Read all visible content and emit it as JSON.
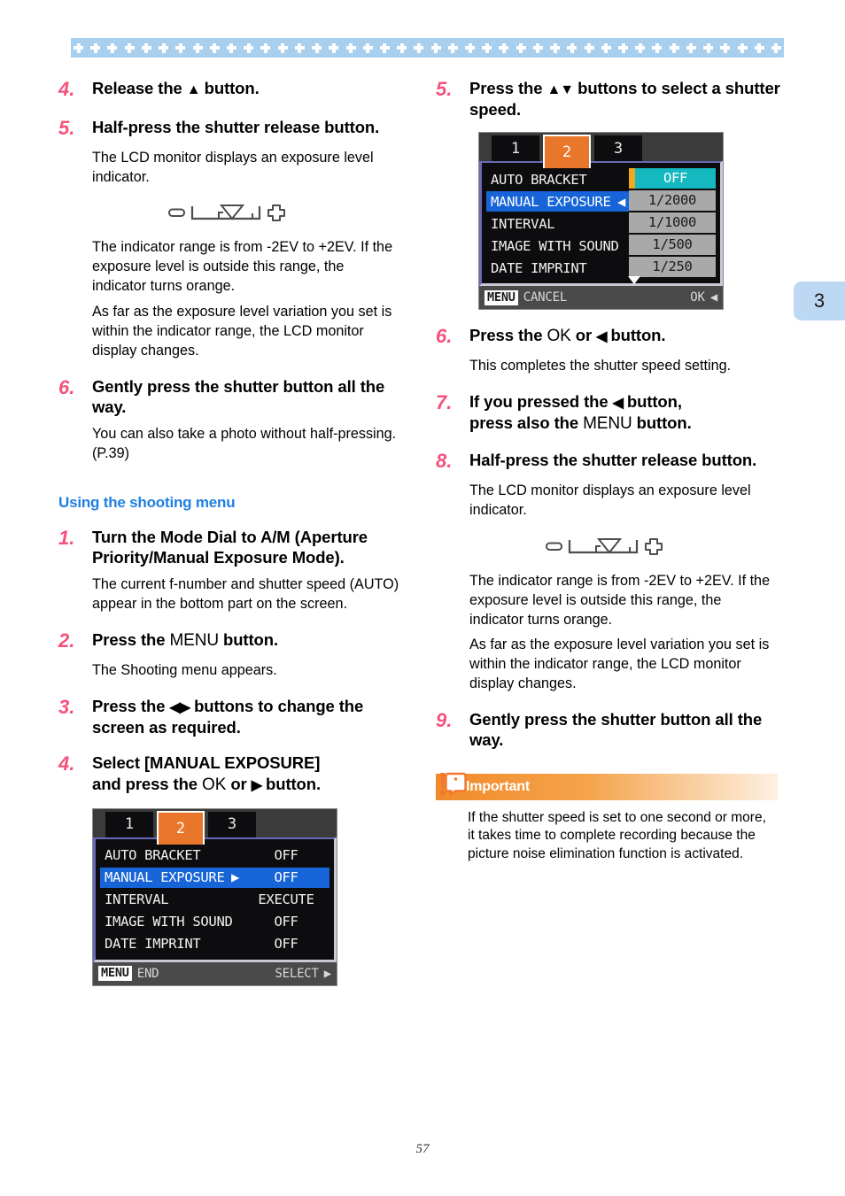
{
  "page": {
    "folio": "57",
    "tab_number": "3"
  },
  "left_column": {
    "steps": [
      {
        "num": "4.",
        "title_pre": "Release the ",
        "icon": "▲",
        "title_post": " button.",
        "paras": []
      },
      {
        "num": "5.",
        "title_pre": "Half-press the shutter release button.",
        "icon": "",
        "title_post": "",
        "paras": [
          "The LCD monitor displays an exposure level indicator."
        ]
      }
    ],
    "after_indicator_paras": [
      "The indicator range is from -2EV to +2EV. If the exposure level is outside this range, the indicator turns orange.",
      "As far as  the exposure level variation you set is within the indicator range, the LCD monitor display changes."
    ],
    "step6": {
      "num": "6.",
      "title": "Gently press the shutter button all the way.",
      "para": "You can also take a photo without half-pressing. (P.39)"
    },
    "section_heading": "Using the shooting menu",
    "menu_steps": [
      {
        "num": "1.",
        "title": "Turn the Mode Dial to A/M (Aperture Priority/Manual Exposure Mode).",
        "para": "The current f-number and shutter speed (AUTO) appear in the bottom part on the screen."
      },
      {
        "num": "2.",
        "title_pre": "Press the ",
        "title_mid": "MENU",
        "title_post": " button.",
        "para": "The Shooting menu appears."
      },
      {
        "num": "3.",
        "title_pre": "Press the ",
        "icon": "◀▶",
        "title_post": " buttons to change the screen as required.",
        "para": ""
      },
      {
        "num": "4.",
        "line1": "Select [MANUAL EXPOSURE]",
        "line2_pre": "and press the ",
        "line2_mid": "OK",
        "line2_join": " or ",
        "line2_icon": "▶",
        "line2_post": " button.",
        "para": ""
      }
    ]
  },
  "right_column": {
    "step5": {
      "num": "5.",
      "title_pre": "Press the ",
      "icon": "▲▼",
      "title_post": " buttons to select a shutter speed."
    },
    "step6": {
      "num": "6.",
      "title_pre": "Press the ",
      "title_mid": "OK",
      "title_join": " or ",
      "icon": "◀",
      "title_post": " button.",
      "para": "This completes the shutter speed setting."
    },
    "step7": {
      "num": "7.",
      "line1_pre": "If you pressed the ",
      "icon": "◀",
      "line1_post": " button,",
      "line2_pre": "press also the ",
      "line2_mid": "MENU",
      "line2_post": " button."
    },
    "step8": {
      "num": "8.",
      "title": "Half-press the shutter release button.",
      "para": "The LCD monitor displays an exposure level indicator."
    },
    "after_indicator_paras": [
      "The indicator range is from -2EV to +2EV. If the exposure level is outside this range, the indicator turns orange.",
      "As far as  the exposure level variation you set is within the indicator range, the LCD monitor display changes."
    ],
    "step9": {
      "num": "9.",
      "title": "Gently press the shutter button all the way."
    },
    "important": {
      "label": "Important",
      "text": "If the shutter speed is set to one second or more, it takes time to complete recording because the picture noise elimination function is activated."
    }
  },
  "lcd_menu_left": {
    "tabs": [
      "1",
      "2",
      "3"
    ],
    "active_tab_index": 1,
    "rows": [
      {
        "label": "AUTO BRACKET",
        "value": "OFF",
        "selected": false
      },
      {
        "label": "MANUAL EXPOSURE",
        "value": "OFF",
        "selected": true,
        "marker": "▶"
      },
      {
        "label": "INTERVAL",
        "value": "EXECUTE",
        "selected": false
      },
      {
        "label": "IMAGE WITH SOUND",
        "value": "OFF",
        "selected": false
      },
      {
        "label": "DATE IMPRINT",
        "value": "OFF",
        "selected": false
      }
    ],
    "footer_left_chip": "MENU",
    "footer_left_label": "END",
    "footer_right_label": "SELECT",
    "footer_right_icon": "▶"
  },
  "lcd_menu_right": {
    "tabs": [
      "1",
      "2",
      "3"
    ],
    "active_tab_index": 1,
    "rows": [
      {
        "label": "AUTO BRACKET",
        "value": "OFF",
        "selected": false,
        "chip": "sel"
      },
      {
        "label": "MANUAL EXPOSURE",
        "value": "1/2000",
        "selected": true,
        "marker": "◀",
        "chip": "plain"
      },
      {
        "label": "INTERVAL",
        "value": "1/1000",
        "selected": false,
        "chip": "plain"
      },
      {
        "label": "IMAGE WITH SOUND",
        "value": "1/500",
        "selected": false,
        "chip": "plain"
      },
      {
        "label": "DATE IMPRINT",
        "value": "1/250",
        "selected": false,
        "chip": "plain"
      }
    ],
    "footer_left_chip": "MENU",
    "footer_left_label": "CANCEL",
    "footer_right_label": "OK",
    "footer_right_icon": "◀"
  },
  "colors": {
    "step_number": "#f4527d",
    "section_heading": "#1f7fe0",
    "band": "#a8cfee",
    "tab_active": "#e8772b",
    "row_highlight": "#1664d8",
    "chip_selected": "#14b8bf",
    "important_bar": "#f08a2a"
  }
}
